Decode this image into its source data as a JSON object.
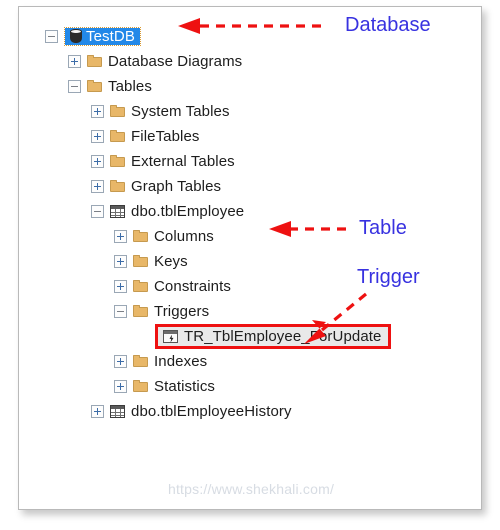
{
  "panel": {
    "watermark": "https://www.shekhali.com/"
  },
  "tree": {
    "nodes": [
      {
        "label": "TestDB",
        "icon": "database-icon",
        "expander": "minus",
        "indent": 0,
        "selected": true
      },
      {
        "label": "Database Diagrams",
        "icon": "folder-icon",
        "expander": "plus",
        "indent": 1
      },
      {
        "label": "Tables",
        "icon": "folder-icon",
        "expander": "minus",
        "indent": 1
      },
      {
        "label": "System Tables",
        "icon": "folder-icon",
        "expander": "plus",
        "indent": 2
      },
      {
        "label": "FileTables",
        "icon": "folder-icon",
        "expander": "plus",
        "indent": 2
      },
      {
        "label": "External Tables",
        "icon": "folder-icon",
        "expander": "plus",
        "indent": 2
      },
      {
        "label": "Graph Tables",
        "icon": "folder-icon",
        "expander": "plus",
        "indent": 2
      },
      {
        "label": "dbo.tblEmployee",
        "icon": "table-icon",
        "expander": "minus",
        "indent": 2
      },
      {
        "label": "Columns",
        "icon": "folder-icon",
        "expander": "plus",
        "indent": 3
      },
      {
        "label": "Keys",
        "icon": "folder-icon",
        "expander": "plus",
        "indent": 3
      },
      {
        "label": "Constraints",
        "icon": "folder-icon",
        "expander": "plus",
        "indent": 3
      },
      {
        "label": "Triggers",
        "icon": "folder-icon",
        "expander": "minus",
        "indent": 3
      },
      {
        "label": "TR_TblEmployee_ForUpdate",
        "icon": "trigger-icon",
        "expander": "none",
        "indent": 4,
        "highlighted": true
      },
      {
        "label": "Indexes",
        "icon": "folder-icon",
        "expander": "plus",
        "indent": 3
      },
      {
        "label": "Statistics",
        "icon": "folder-icon",
        "expander": "plus",
        "indent": 3
      },
      {
        "label": "dbo.tblEmployeeHistory",
        "icon": "table-icon",
        "expander": "plus",
        "indent": 2
      }
    ]
  },
  "annotations": {
    "color": "#3832e0",
    "arrow_color": "#ee1111",
    "items": [
      {
        "label": "Database",
        "target": "TestDB"
      },
      {
        "label": "Table",
        "target": "dbo.tblEmployee"
      },
      {
        "label": "Trigger",
        "target": "TR_TblEmployee_ForUpdate"
      }
    ]
  }
}
